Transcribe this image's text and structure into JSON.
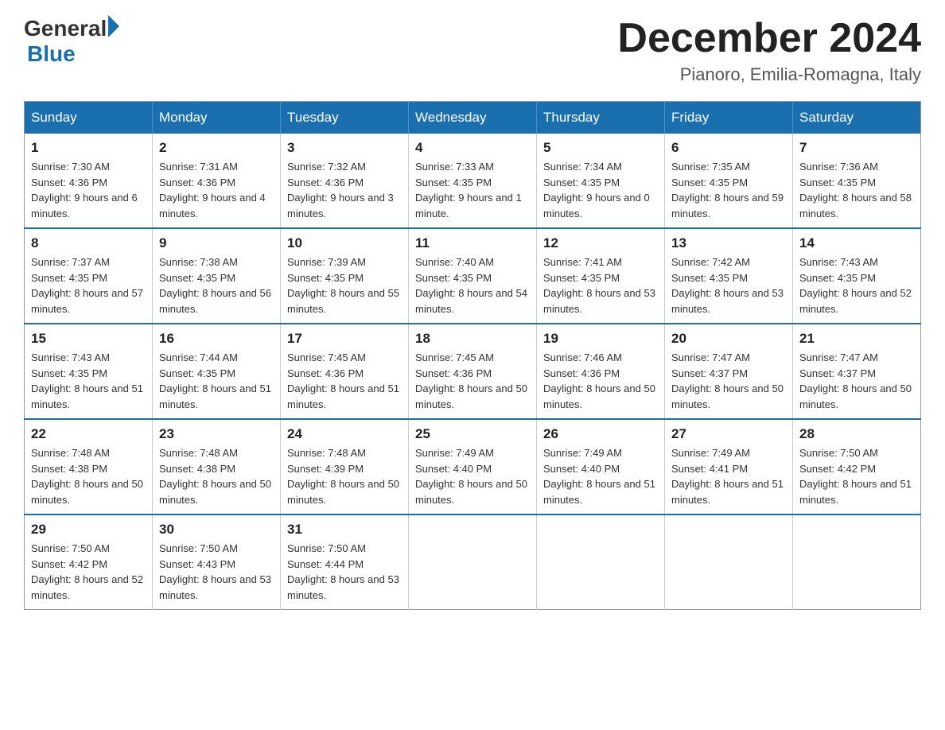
{
  "header": {
    "logo": {
      "text_general": "General",
      "text_blue": "Blue",
      "alt": "GeneralBlue logo"
    },
    "title": "December 2024",
    "location": "Pianoro, Emilia-Romagna, Italy"
  },
  "calendar": {
    "days_of_week": [
      "Sunday",
      "Monday",
      "Tuesday",
      "Wednesday",
      "Thursday",
      "Friday",
      "Saturday"
    ],
    "weeks": [
      [
        {
          "day": "1",
          "sunrise": "7:30 AM",
          "sunset": "4:36 PM",
          "daylight": "9 hours and 6 minutes."
        },
        {
          "day": "2",
          "sunrise": "7:31 AM",
          "sunset": "4:36 PM",
          "daylight": "9 hours and 4 minutes."
        },
        {
          "day": "3",
          "sunrise": "7:32 AM",
          "sunset": "4:36 PM",
          "daylight": "9 hours and 3 minutes."
        },
        {
          "day": "4",
          "sunrise": "7:33 AM",
          "sunset": "4:35 PM",
          "daylight": "9 hours and 1 minute."
        },
        {
          "day": "5",
          "sunrise": "7:34 AM",
          "sunset": "4:35 PM",
          "daylight": "9 hours and 0 minutes."
        },
        {
          "day": "6",
          "sunrise": "7:35 AM",
          "sunset": "4:35 PM",
          "daylight": "8 hours and 59 minutes."
        },
        {
          "day": "7",
          "sunrise": "7:36 AM",
          "sunset": "4:35 PM",
          "daylight": "8 hours and 58 minutes."
        }
      ],
      [
        {
          "day": "8",
          "sunrise": "7:37 AM",
          "sunset": "4:35 PM",
          "daylight": "8 hours and 57 minutes."
        },
        {
          "day": "9",
          "sunrise": "7:38 AM",
          "sunset": "4:35 PM",
          "daylight": "8 hours and 56 minutes."
        },
        {
          "day": "10",
          "sunrise": "7:39 AM",
          "sunset": "4:35 PM",
          "daylight": "8 hours and 55 minutes."
        },
        {
          "day": "11",
          "sunrise": "7:40 AM",
          "sunset": "4:35 PM",
          "daylight": "8 hours and 54 minutes."
        },
        {
          "day": "12",
          "sunrise": "7:41 AM",
          "sunset": "4:35 PM",
          "daylight": "8 hours and 53 minutes."
        },
        {
          "day": "13",
          "sunrise": "7:42 AM",
          "sunset": "4:35 PM",
          "daylight": "8 hours and 53 minutes."
        },
        {
          "day": "14",
          "sunrise": "7:43 AM",
          "sunset": "4:35 PM",
          "daylight": "8 hours and 52 minutes."
        }
      ],
      [
        {
          "day": "15",
          "sunrise": "7:43 AM",
          "sunset": "4:35 PM",
          "daylight": "8 hours and 51 minutes."
        },
        {
          "day": "16",
          "sunrise": "7:44 AM",
          "sunset": "4:35 PM",
          "daylight": "8 hours and 51 minutes."
        },
        {
          "day": "17",
          "sunrise": "7:45 AM",
          "sunset": "4:36 PM",
          "daylight": "8 hours and 51 minutes."
        },
        {
          "day": "18",
          "sunrise": "7:45 AM",
          "sunset": "4:36 PM",
          "daylight": "8 hours and 50 minutes."
        },
        {
          "day": "19",
          "sunrise": "7:46 AM",
          "sunset": "4:36 PM",
          "daylight": "8 hours and 50 minutes."
        },
        {
          "day": "20",
          "sunrise": "7:47 AM",
          "sunset": "4:37 PM",
          "daylight": "8 hours and 50 minutes."
        },
        {
          "day": "21",
          "sunrise": "7:47 AM",
          "sunset": "4:37 PM",
          "daylight": "8 hours and 50 minutes."
        }
      ],
      [
        {
          "day": "22",
          "sunrise": "7:48 AM",
          "sunset": "4:38 PM",
          "daylight": "8 hours and 50 minutes."
        },
        {
          "day": "23",
          "sunrise": "7:48 AM",
          "sunset": "4:38 PM",
          "daylight": "8 hours and 50 minutes."
        },
        {
          "day": "24",
          "sunrise": "7:48 AM",
          "sunset": "4:39 PM",
          "daylight": "8 hours and 50 minutes."
        },
        {
          "day": "25",
          "sunrise": "7:49 AM",
          "sunset": "4:40 PM",
          "daylight": "8 hours and 50 minutes."
        },
        {
          "day": "26",
          "sunrise": "7:49 AM",
          "sunset": "4:40 PM",
          "daylight": "8 hours and 51 minutes."
        },
        {
          "day": "27",
          "sunrise": "7:49 AM",
          "sunset": "4:41 PM",
          "daylight": "8 hours and 51 minutes."
        },
        {
          "day": "28",
          "sunrise": "7:50 AM",
          "sunset": "4:42 PM",
          "daylight": "8 hours and 51 minutes."
        }
      ],
      [
        {
          "day": "29",
          "sunrise": "7:50 AM",
          "sunset": "4:42 PM",
          "daylight": "8 hours and 52 minutes."
        },
        {
          "day": "30",
          "sunrise": "7:50 AM",
          "sunset": "4:43 PM",
          "daylight": "8 hours and 53 minutes."
        },
        {
          "day": "31",
          "sunrise": "7:50 AM",
          "sunset": "4:44 PM",
          "daylight": "8 hours and 53 minutes."
        },
        null,
        null,
        null,
        null
      ]
    ]
  }
}
